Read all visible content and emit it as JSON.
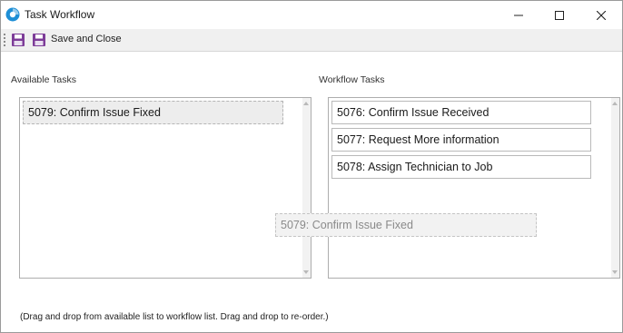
{
  "window": {
    "title": "Task Workflow",
    "icon": "app-logo-icon"
  },
  "toolbar": {
    "save_icon": "floppy-disk-icon",
    "save_close_icon": "floppy-disk-icon",
    "save_close_label": "Save and Close",
    "icon_color": "#7d3c98"
  },
  "available": {
    "label": "Available Tasks",
    "items": [
      "5079: Confirm Issue Fixed"
    ]
  },
  "workflow": {
    "label": "Workflow Tasks",
    "items": [
      "5076: Confirm Issue Received",
      "5077: Request More information",
      "5078: Assign Technician to Job"
    ]
  },
  "drag_ghost": {
    "text": "5079: Confirm Issue Fixed"
  },
  "hint": "(Drag and drop from available list to workflow list. Drag and drop to re-order.)"
}
